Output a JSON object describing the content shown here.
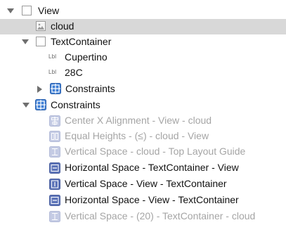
{
  "tree": {
    "view": {
      "label": "View",
      "icon": "view-icon",
      "expanded": true
    },
    "cloud": {
      "label": "cloud",
      "icon": "image-view-icon",
      "selected": true
    },
    "text_container": {
      "label": "TextContainer",
      "icon": "view-icon",
      "expanded": true,
      "children": [
        {
          "badge": "Lbl",
          "label": "Cupertino",
          "icon": "label-icon"
        },
        {
          "badge": "Lbl",
          "label": "28C",
          "icon": "label-icon"
        }
      ],
      "constraints": {
        "label": "Constraints",
        "icon": "constraints-icon",
        "expanded": false
      }
    },
    "constraints": {
      "label": "Constraints",
      "icon": "constraints-icon",
      "expanded": true,
      "items": [
        {
          "label": "Center X Alignment - View - cloud",
          "icon": "center-x-alignment-icon",
          "dimmed": true
        },
        {
          "label": "Equal Heights - (≤) - cloud - View",
          "icon": "equal-heights-icon",
          "dimmed": true
        },
        {
          "label": "Vertical Space - cloud - Top Layout Guide",
          "icon": "vertical-space-icon",
          "dimmed": true
        },
        {
          "label": "Horizontal Space - TextContainer - View",
          "icon": "horizontal-space-icon",
          "dimmed": false
        },
        {
          "label": "Vertical Space - View - TextContainer",
          "icon": "vertical-space-icon",
          "dimmed": false
        },
        {
          "label": "Horizontal Space - View - TextContainer",
          "icon": "horizontal-space-icon",
          "dimmed": false
        },
        {
          "label": "Vertical Space - (20) - TextContainer - cloud",
          "icon": "vertical-space-icon",
          "dimmed": true
        }
      ]
    }
  },
  "colors": {
    "selection": "#d8d8d8",
    "constraint_active": "#5d74b8",
    "constraint_dimmed": "#c4cbe4",
    "text_dimmed": "#a5a5a5",
    "constraints_folder": "#3f7fd6"
  }
}
